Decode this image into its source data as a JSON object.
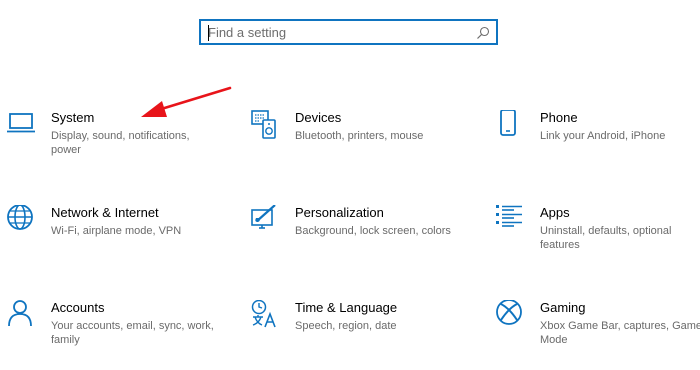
{
  "search": {
    "placeholder": "Find a setting",
    "icon": "search-icon"
  },
  "colors": {
    "accent": "#0f74c0",
    "annotation_arrow": "#e8141a"
  },
  "tiles": [
    {
      "title": "System",
      "desc": "Display, sound, notifications, power",
      "icon": "laptop-icon"
    },
    {
      "title": "Devices",
      "desc": "Bluetooth, printers, mouse",
      "icon": "devices-icon"
    },
    {
      "title": "Phone",
      "desc": "Link your Android, iPhone",
      "icon": "phone-icon"
    },
    {
      "title": "Network & Internet",
      "desc": "Wi-Fi, airplane mode, VPN",
      "icon": "globe-icon"
    },
    {
      "title": "Personalization",
      "desc": "Background, lock screen, colors",
      "icon": "personalization-icon"
    },
    {
      "title": "Apps",
      "desc": "Uninstall, defaults, optional features",
      "icon": "apps-list-icon"
    },
    {
      "title": "Accounts",
      "desc": "Your accounts, email, sync, work, family",
      "icon": "person-icon"
    },
    {
      "title": "Time & Language",
      "desc": "Speech, region, date",
      "icon": "time-language-icon"
    },
    {
      "title": "Gaming",
      "desc": "Xbox Game Bar, captures, Game Mode",
      "icon": "xbox-icon"
    }
  ]
}
